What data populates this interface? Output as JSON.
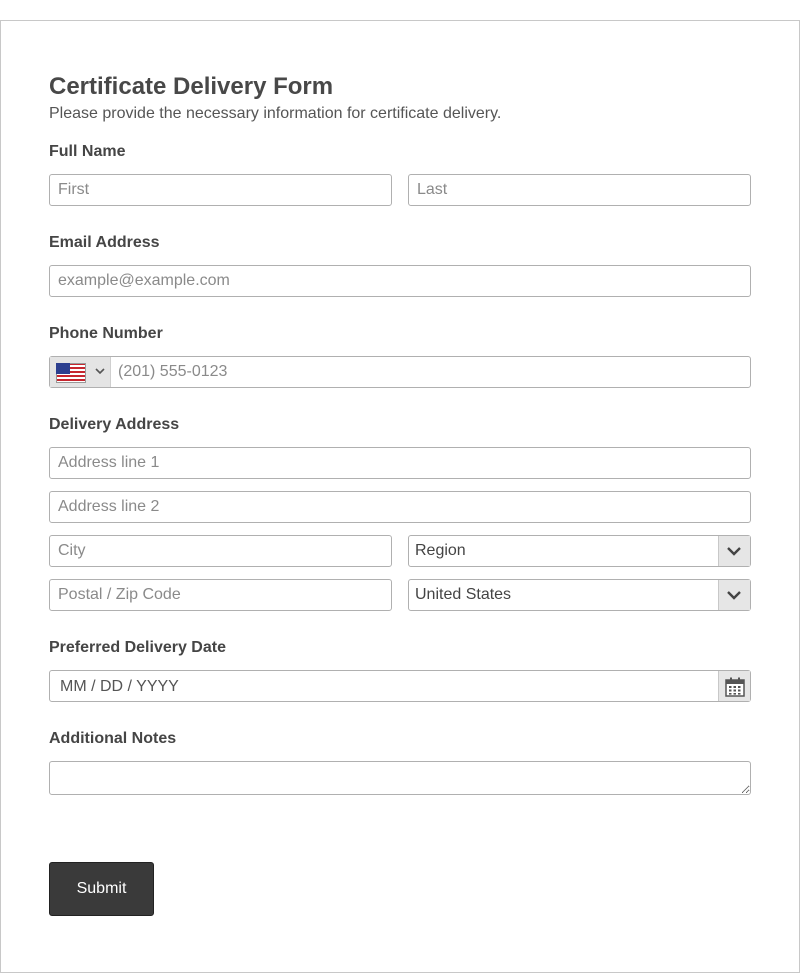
{
  "form": {
    "title": "Certificate Delivery Form",
    "subtitle": "Please provide the necessary information for certificate delivery."
  },
  "full_name": {
    "label": "Full Name",
    "first_placeholder": "First",
    "last_placeholder": "Last"
  },
  "email": {
    "label": "Email Address",
    "placeholder": "example@example.com"
  },
  "phone": {
    "label": "Phone Number",
    "country_flag": "us-flag-icon",
    "placeholder": "(201) 555-0123"
  },
  "address": {
    "label": "Delivery Address",
    "line1_placeholder": "Address line 1",
    "line2_placeholder": "Address line 2",
    "city_placeholder": "City",
    "region_value": "Region",
    "postal_placeholder": "Postal / Zip Code",
    "country_value": "United States"
  },
  "delivery_date": {
    "label": "Preferred Delivery Date",
    "placeholder": "MM / DD / YYYY"
  },
  "notes": {
    "label": "Additional Notes"
  },
  "submit": {
    "label": "Submit"
  },
  "colors": {
    "button_bg": "#3a3a3a",
    "border": "#b0b0b0",
    "text": "#444444"
  }
}
